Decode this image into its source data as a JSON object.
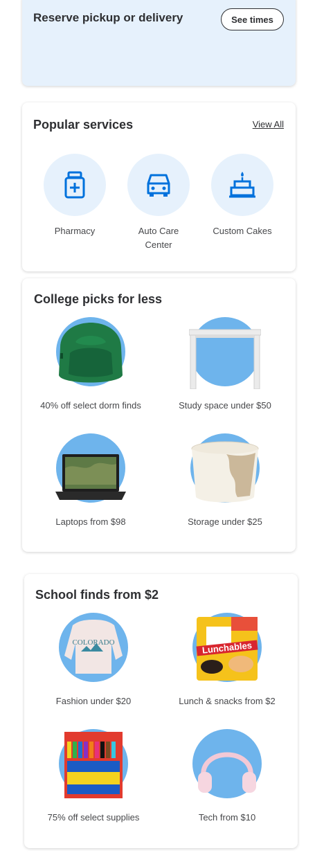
{
  "reserve": {
    "title": "Reserve pickup or delivery",
    "button": "See times"
  },
  "services": {
    "title": "Popular services",
    "view_all": "View All",
    "items": [
      {
        "label": "Pharmacy",
        "icon": "pharmacy-bottle-icon"
      },
      {
        "label": "Auto Care Center",
        "icon": "car-icon"
      },
      {
        "label": "Custom Cakes",
        "icon": "cake-icon"
      }
    ]
  },
  "college": {
    "title": "College picks for less",
    "items": [
      {
        "label": "40% off select dorm finds",
        "image": "green-bean-bag-chair"
      },
      {
        "label": "Study space under $50",
        "image": "white-desk"
      },
      {
        "label": "Laptops from $98",
        "image": "laptop"
      },
      {
        "label": "Storage under $25",
        "image": "fabric-storage-bin"
      }
    ]
  },
  "school": {
    "title": "School finds from $2",
    "items": [
      {
        "label": "Fashion under $20",
        "image": "colorado-sweatshirt"
      },
      {
        "label": "Lunch & snacks from $2",
        "image": "lunchables-pack"
      },
      {
        "label": "75% off select supplies",
        "image": "crayola-markers"
      },
      {
        "label": "Tech from $10",
        "image": "pink-headphones"
      }
    ]
  },
  "colors": {
    "accent_blue": "#0071dc",
    "light_blue": "#e6f1fc",
    "circle_blue": "#6eb4ec"
  }
}
